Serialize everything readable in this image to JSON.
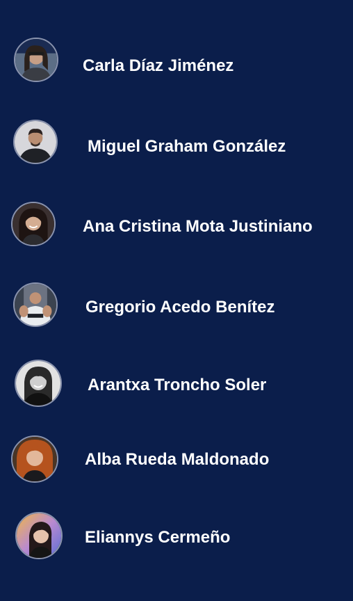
{
  "members": [
    {
      "name": "Carla Díaz Jiménez",
      "avatar_icon": "person-photo-icon"
    },
    {
      "name": "Miguel Graham González",
      "avatar_icon": "person-photo-icon"
    },
    {
      "name": "Ana Cristina Mota Justiniano",
      "avatar_icon": "person-photo-icon"
    },
    {
      "name": "Gregorio Acedo Benítez",
      "avatar_icon": "person-photo-icon"
    },
    {
      "name": "Arantxa Troncho Soler",
      "avatar_icon": "person-photo-icon"
    },
    {
      "name": "Alba Rueda Maldonado",
      "avatar_icon": "person-photo-icon"
    },
    {
      "name": "Eliannys Cermeño",
      "avatar_icon": "person-photo-icon"
    }
  ],
  "colors": {
    "background": "#0b1e4b",
    "text": "#ffffff",
    "avatar_ring": "#8a93ad"
  }
}
